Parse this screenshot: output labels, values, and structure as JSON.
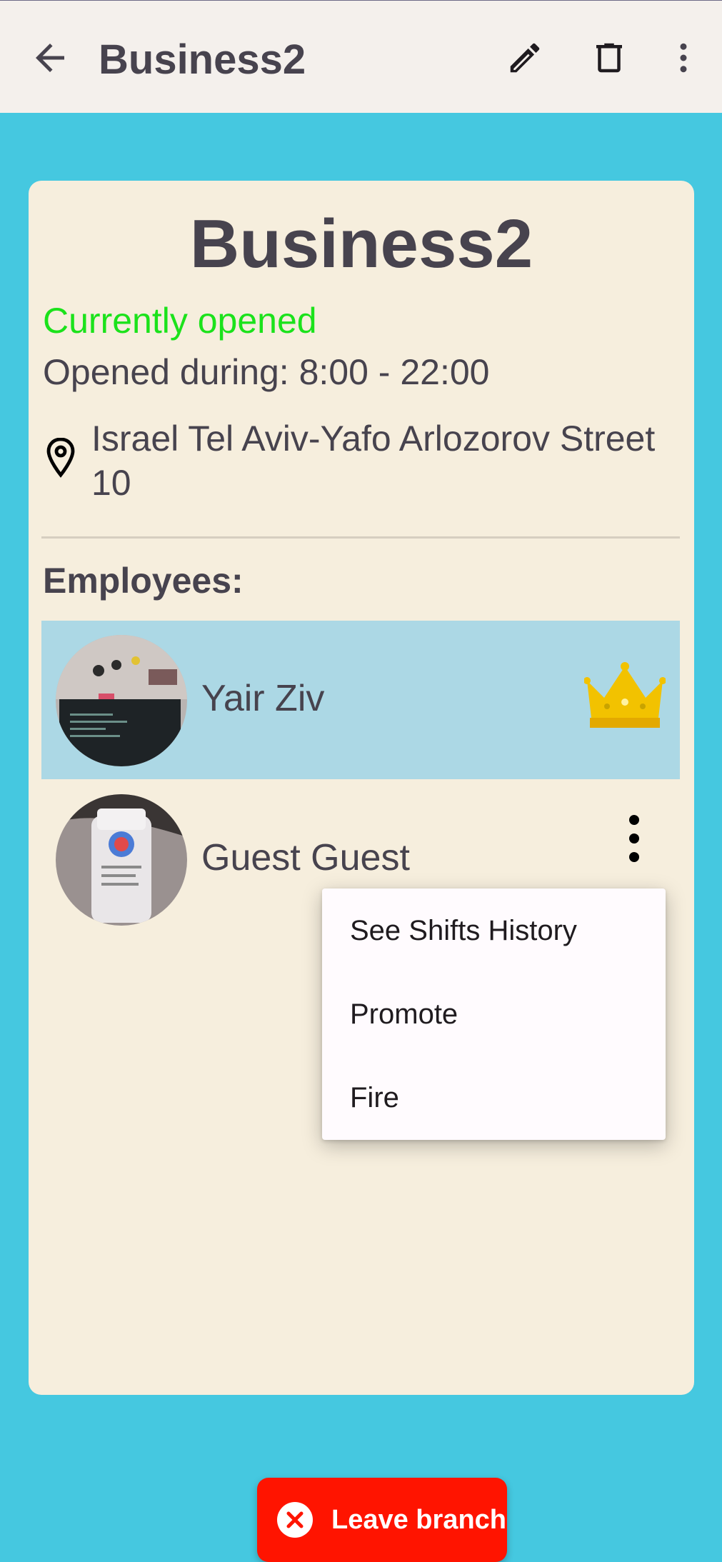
{
  "appbar": {
    "title": "Business2",
    "back_icon": "arrow-back-icon",
    "edit_icon": "pencil-icon",
    "delete_icon": "trash-icon",
    "more_icon": "more-vert-icon",
    "background": "#f4f0ec"
  },
  "business": {
    "name": "Business2",
    "status": "Currently opened",
    "status_color": "#1be21b",
    "hours": "Opened during: 8:00 - 22:00",
    "address": "Israel Tel Aviv-Yafo Arlozorov Street 10",
    "address_icon": "location-pin-icon"
  },
  "employees": {
    "heading": "Employees:",
    "items": [
      {
        "name": "Yair Ziv",
        "badge_icon": "crown-icon",
        "selected": true
      },
      {
        "name": "Guest Guest",
        "menu_icon": "more-vert-icon",
        "selected": false
      }
    ]
  },
  "context_menu": {
    "items": [
      "See Shifts History",
      "Promote",
      "Fire"
    ]
  },
  "leave_button": {
    "label": "Leave branch",
    "icon": "close-circle-icon",
    "color": "#ff1400"
  },
  "colors": {
    "page_background": "#45c8e0",
    "card_background": "#f6eedd",
    "selected_row": "#acd8e5"
  }
}
